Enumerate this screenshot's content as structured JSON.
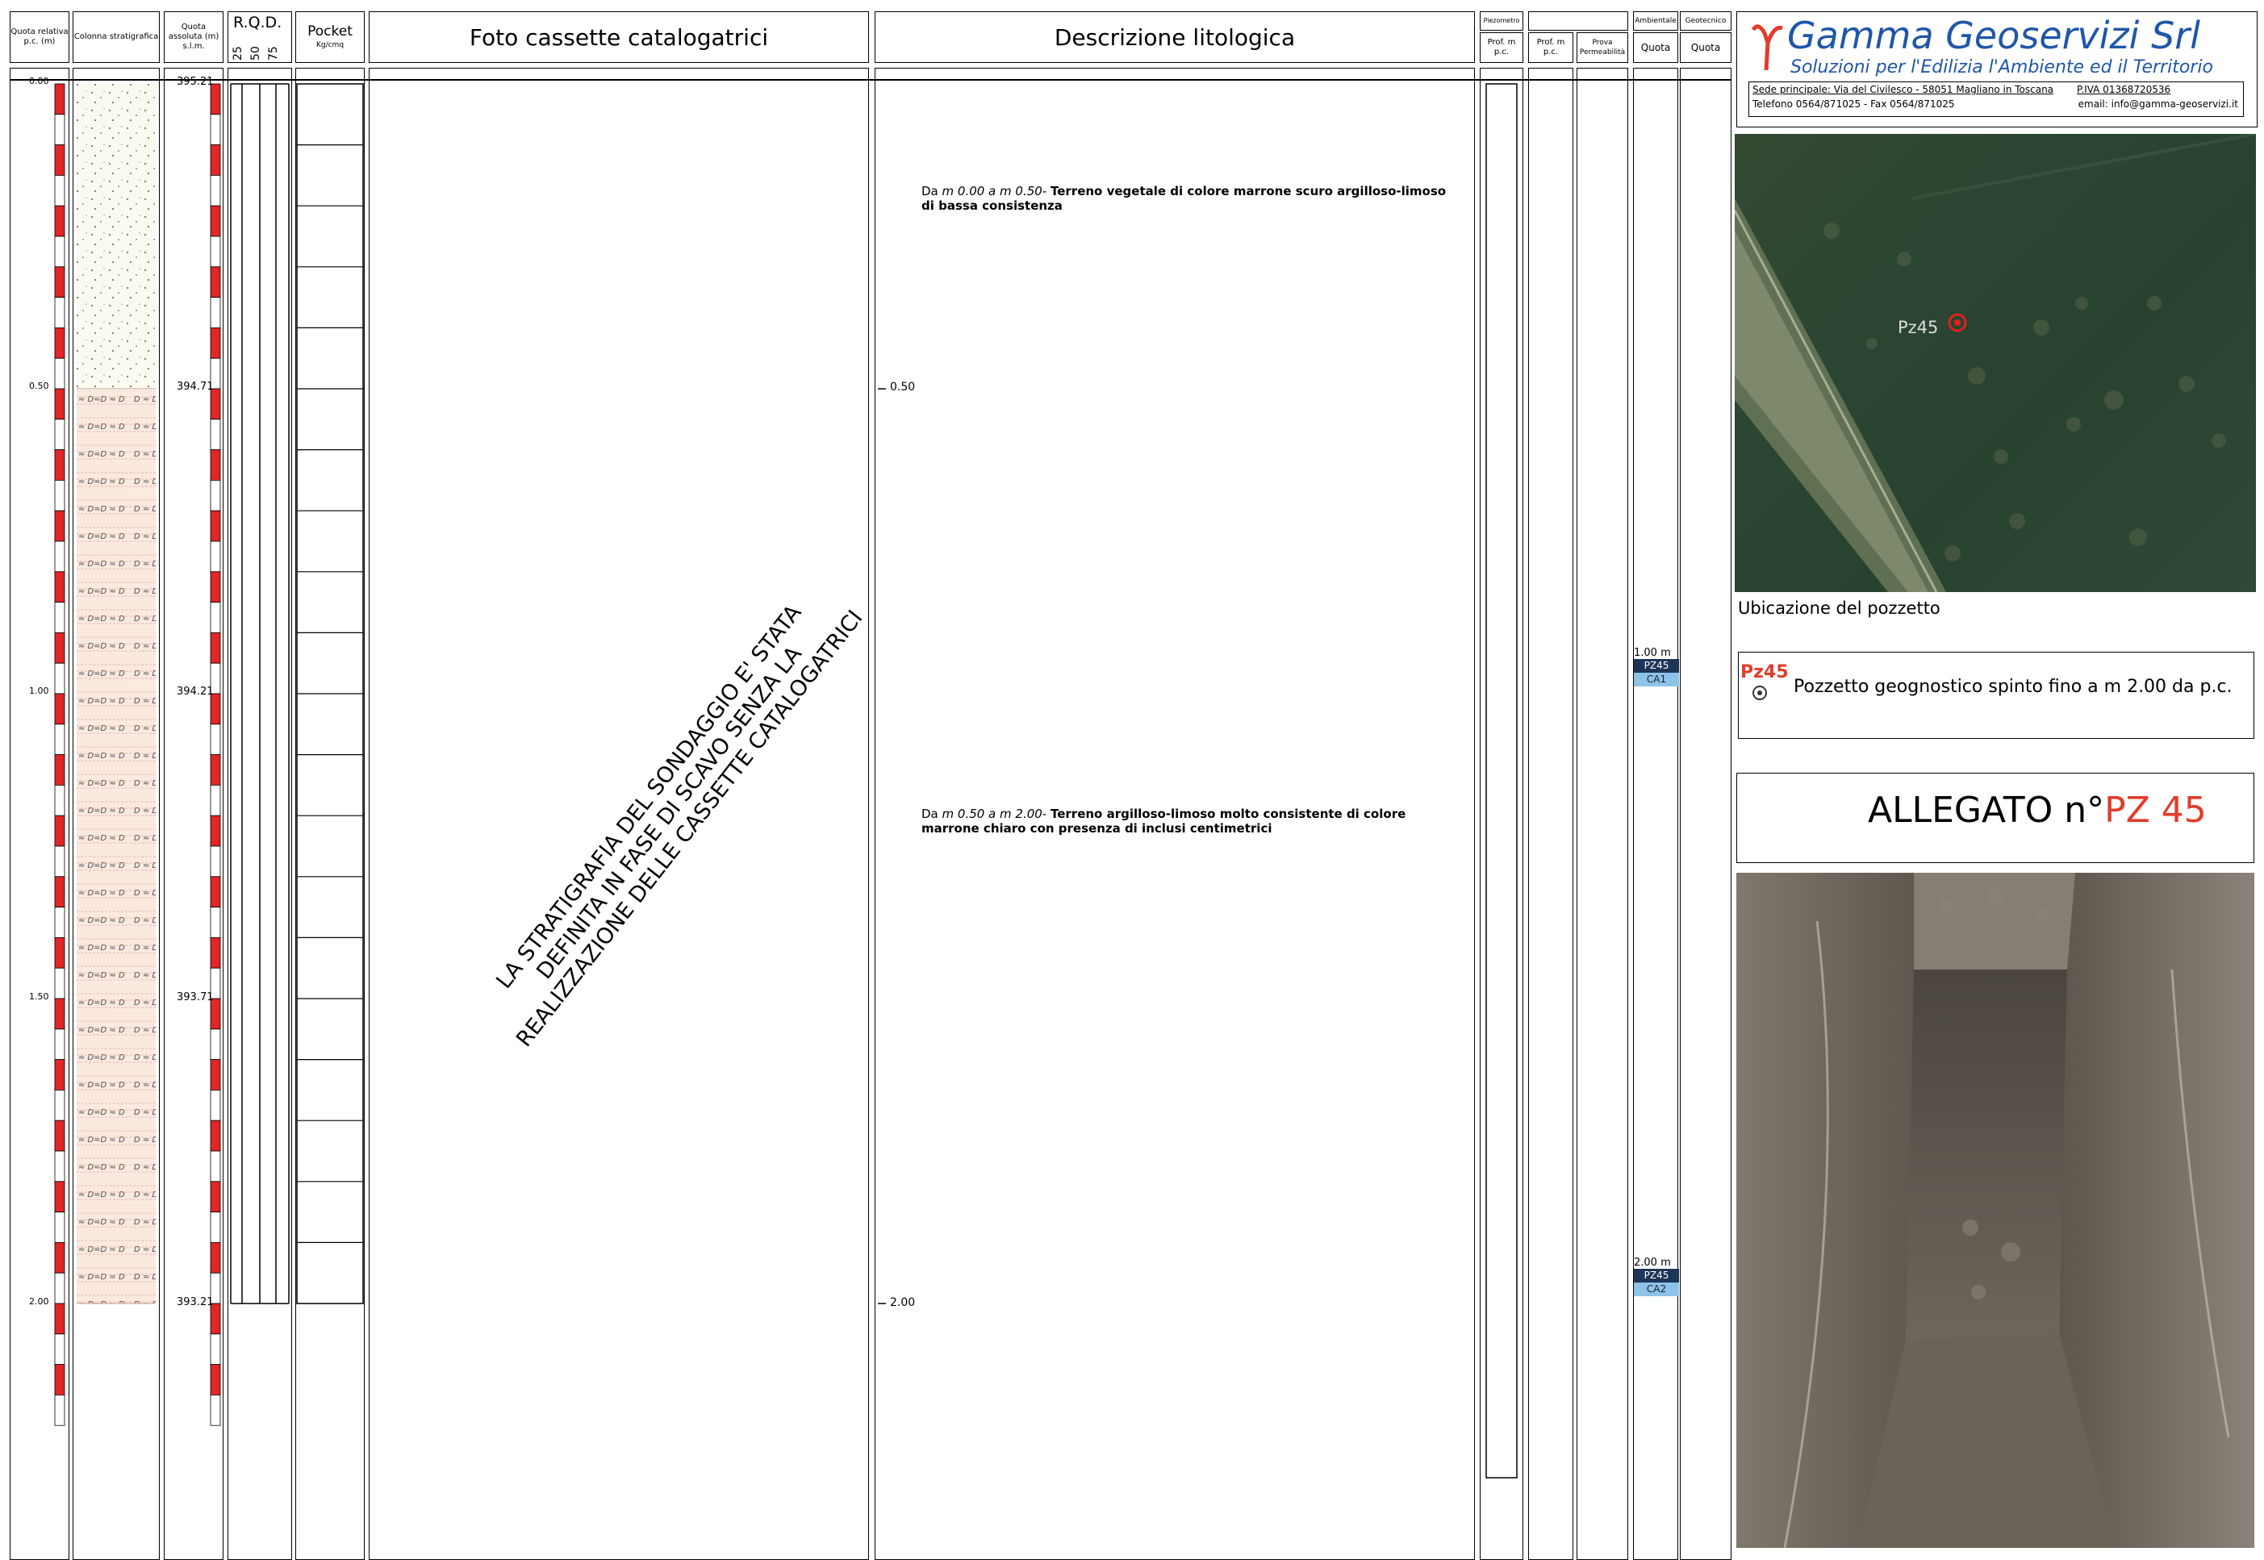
{
  "headers": {
    "quota_relativa": "Quota relativa p.c. (m)",
    "colonna": "Colonna stratigrafica",
    "quota_assoluta": "Quota assoluta (m) s.l.m.",
    "rqd": "R.Q.D.",
    "rqd_scale": [
      "25",
      "50",
      "75"
    ],
    "pocket": "Pocket",
    "pocket_unit": "Kg/cmq",
    "foto": "Foto cassette catalogatrici",
    "descrizione": "Descrizione litologica",
    "piezometro": "Piezometro",
    "prof_mpc": "Prof. m p.c.",
    "prof_mpc2": "Prof. m p.c.",
    "prova_perm": "Prova Permeabilità",
    "ambientale": "Ambientale",
    "geotecnico": "Geotecnico",
    "quota1": "Quota",
    "quota2": "Quota"
  },
  "depth_ticks": [
    "0.00",
    "0.50",
    "1.00",
    "1.50",
    "2.00"
  ],
  "abs_ticks": [
    "395.21",
    "394.71",
    "394.21",
    "393.71",
    "393.21"
  ],
  "description": {
    "tick1": "0.50",
    "tick2": "2.00",
    "layer1_prefix": "Da ",
    "layer1_range": "m 0.00 a m 0.50-",
    "layer1_text": "Terreno vegetale di colore marrone scuro argilloso-limoso di bassa consistenza",
    "layer2_prefix": "Da ",
    "layer2_range": "m 0.50 a m 2.00-",
    "layer2_text": "Terreno argilloso-limoso molto consistente di colore marrone chiaro con presenza di inclusi centimetrici"
  },
  "photo_note": "LA STRATIGRAFIA DEL SONDAGGIO E' STATA DEFINITA IN FASE DI SCAVO SENZA LA REALIZZAZIONE DELLE CASSETTE CATALOGATRICI",
  "samples": [
    {
      "depth": "1.00 m",
      "code": "PZ45",
      "id": "CA1"
    },
    {
      "depth": "2.00 m",
      "code": "PZ45",
      "id": "CA2"
    }
  ],
  "company": {
    "name_part1": "Gamma ",
    "name_part2": "Geoservizi Srl",
    "tagline": "Soluzioni per l'Edilizia l'Ambiente ed il Territorio",
    "address": "Sede principale: Via del Civilesco - 58051 Magliano in Toscana",
    "piva": "P.IVA 01368720536",
    "phone": "Telefono 0564/871025 - Fax 0564/871025",
    "email": "email: info@gamma-geoservizi.it",
    "accent_color": "#e23b2a",
    "blue_color": "#1f56a8"
  },
  "map": {
    "label": "Pz45",
    "caption": "Ubicazione del pozzetto"
  },
  "legend": {
    "code": "Pz45",
    "text": "Pozzetto geognostico spinto fino a m 2.00 da p.c."
  },
  "allegato": {
    "prefix": "ALLEGATO n°",
    "code": "PZ 45"
  }
}
